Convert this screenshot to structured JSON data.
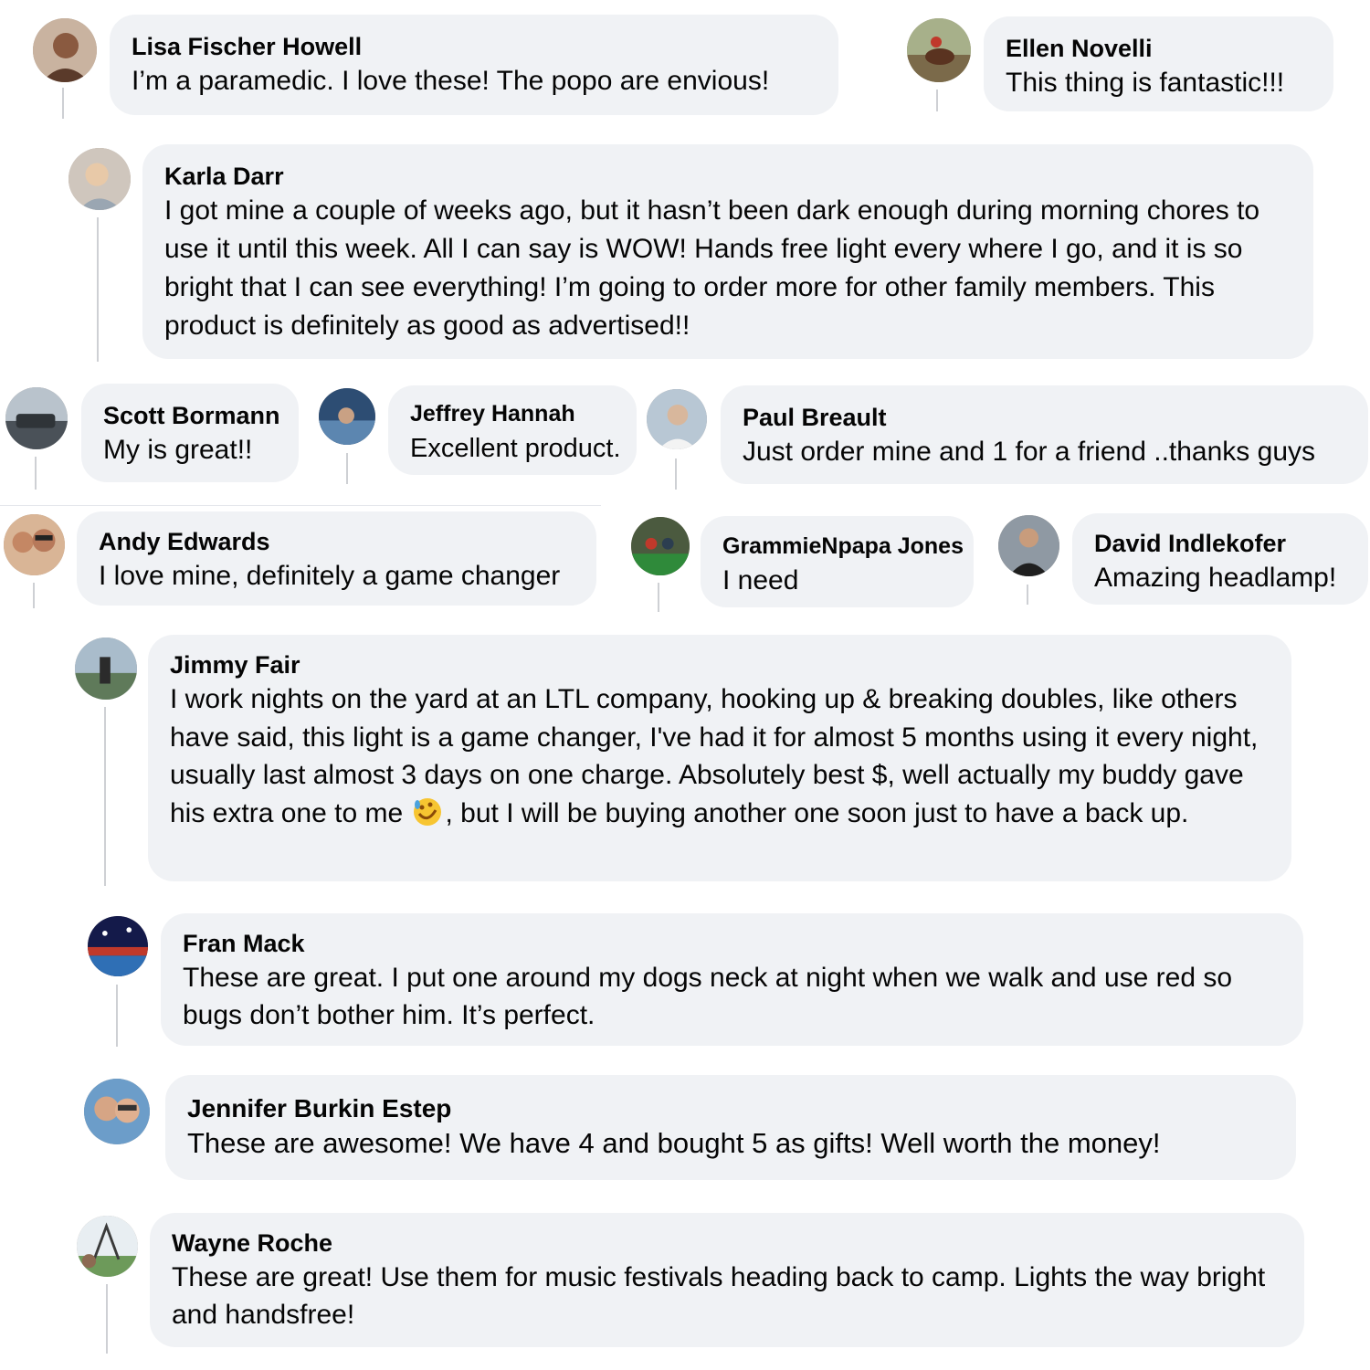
{
  "comments": [
    {
      "id": "lisa",
      "name": "Lisa Fischer Howell",
      "text": "I’m a paramedic. I love these! The popo are envious!",
      "avatar_icon": "user-avatar-photo",
      "avatar_color": "#a58a78"
    },
    {
      "id": "ellen",
      "name": "Ellen Novelli",
      "text": "This thing is fantastic!!!",
      "avatar_icon": "user-avatar-photo",
      "avatar_color": "#8d7a5e"
    },
    {
      "id": "karla",
      "name": "Karla Darr",
      "text": "I got mine a couple of weeks ago, but it hasn’t been dark enough during morning chores to use it until this week. All I can say is WOW! Hands free light every where I go, and it is so bright that I can see everything! I’m going to order more for other family members. This product is definitely as good as advertised!!",
      "avatar_icon": "user-avatar-photo",
      "avatar_color": "#b9aea4"
    },
    {
      "id": "scott",
      "name": "Scott Bormann",
      "text": "My is great!!",
      "avatar_icon": "user-avatar-photo",
      "avatar_color": "#6b7580"
    },
    {
      "id": "jeffrey",
      "name": "Jeffrey Hannah",
      "text": "Excellent product.",
      "avatar_icon": "user-avatar-photo",
      "avatar_color": "#3f5f85"
    },
    {
      "id": "paul",
      "name": "Paul Breault",
      "text": "Just order mine and 1 for a friend ..thanks guys",
      "avatar_icon": "user-avatar-photo",
      "avatar_color": "#9aa9b8"
    },
    {
      "id": "andy",
      "name": "Andy Edwards",
      "text": "I love mine, definitely a game changer",
      "avatar_icon": "user-avatar-photo",
      "avatar_color": "#c08a6a"
    },
    {
      "id": "grammie",
      "name": "GrammieNpapa Jones",
      "text": "I need",
      "avatar_icon": "user-avatar-photo",
      "avatar_color": "#5b6a4e"
    },
    {
      "id": "david",
      "name": "David Indlekofer",
      "text": "Amazing headlamp!",
      "avatar_icon": "user-avatar-photo",
      "avatar_color": "#6d7682"
    },
    {
      "id": "jimmy",
      "name": "Jimmy Fair",
      "text_before_emoji": "I work nights on the yard at an LTL company, hooking up & breaking doubles, like others have said, this light is a game changer, I've had it for almost 5 months using it every night, usually last almost 3 days on one charge. Absolutely best $, well actually my buddy gave his extra one to me",
      "emoji": "rolling-on-floor-laughing-emoji",
      "text_after_emoji": ", but I will be buying another one soon just to have a back up.",
      "avatar_icon": "user-avatar-photo",
      "avatar_color": "#7f8c8d"
    },
    {
      "id": "fran",
      "name": "Fran Mack",
      "text": "These are great. I put one around my dogs neck at night when we walk and use red so bugs don’t bother him. It’s perfect.",
      "avatar_icon": "user-avatar-photo",
      "avatar_color": "#1f2a6b"
    },
    {
      "id": "jennifer",
      "name": "Jennifer Burkin Estep",
      "text": "These are awesome! We have 4 and bought 5 as gifts! Well worth the money!",
      "avatar_icon": "user-avatar-photo",
      "avatar_color": "#4d7fb0"
    },
    {
      "id": "wayne",
      "name": "Wayne Roche",
      "text": "These are great! Use them for music festivals heading back to camp. Lights the way bright and handsfree!",
      "avatar_icon": "user-avatar-photo",
      "avatar_color": "#7a9c6a"
    }
  ],
  "colors": {
    "bubble": "#f0f2f5",
    "text": "#050505",
    "thread": "#ced0d4"
  }
}
